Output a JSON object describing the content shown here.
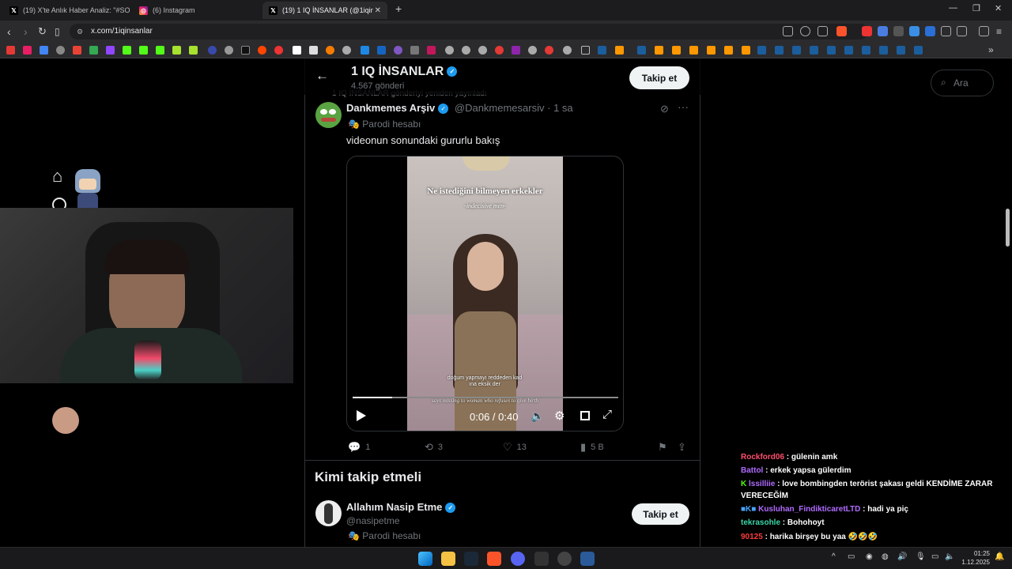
{
  "browser": {
    "tabs": [
      {
        "title": "(19) X'te Anlık Haber Analiz: \"#SONDAKİ",
        "active": false
      },
      {
        "title": "(6) Instagram",
        "active": false
      },
      {
        "title": "(19) 1 IQ İNSANLAR (@1iqinsanlar",
        "active": true
      }
    ],
    "url": "x.com/1iqinsanlar"
  },
  "profile_header": {
    "name": "1 IQ İNSANLAR",
    "posts_count": "4.567 gönderi",
    "follow_label": "Takip et"
  },
  "search": {
    "placeholder": "Ara"
  },
  "tweet": {
    "repost_note": "1 IQ İNSANLAR gönderiyi yeniden yayınladı",
    "author_name": "Dankmemes Arşiv",
    "handle": "@Dankmemesarsiv",
    "time": "· 1 sa",
    "parody_label": "Parodi hesabı",
    "text": "videonun sonundaki gururlu bakış",
    "video": {
      "caption_top": "Ne istediğini bilmeyen erkekler",
      "caption_sub": "-indecisive men-",
      "caption_bottom": "doğum yapmayı reddeden kad ına eksik der",
      "caption_bottom_en": "says missing to woman who refuses to give birth",
      "time_display": "0:06 / 0:40",
      "progress": 0.15
    },
    "stats": {
      "replies": "1",
      "reposts": "3",
      "likes": "13",
      "views": "5 B"
    }
  },
  "who_to_follow": {
    "heading": "Kimi takip etmeli",
    "user_name": "Allahım Nasip Etme",
    "user_handle": "@nasipetme",
    "user_label": "Parodi hesabı",
    "follow_label": "Takip et"
  },
  "chat": {
    "messages": [
      {
        "user": "Rockford06",
        "color": "#ff4f6d",
        "text": "gülenin amk"
      },
      {
        "user": "Battol",
        "color": "#b06bff",
        "text": "erkek yapsa gülerdim"
      },
      {
        "user": "lssilliie",
        "color": "#b06bff",
        "text": "love bombingden terörist şakası geldi KENDİME ZARAR"
      },
      {
        "user": "",
        "color": "#ffffff",
        "text": "VERECEĞİM"
      },
      {
        "user": "Kusluhan_FindikticaretLTD",
        "color": "#b06bff",
        "text": "hadi ya piç"
      },
      {
        "user": "tekrasohle",
        "color": "#3ad6a8",
        "text": "Bohohoyt"
      },
      {
        "user": "90125",
        "color": "#ff3b3b",
        "text": "harika birşey bu yaa 🤣🤣🤣"
      }
    ]
  },
  "clock": {
    "time": "01:25",
    "date": "1.12.2025"
  }
}
